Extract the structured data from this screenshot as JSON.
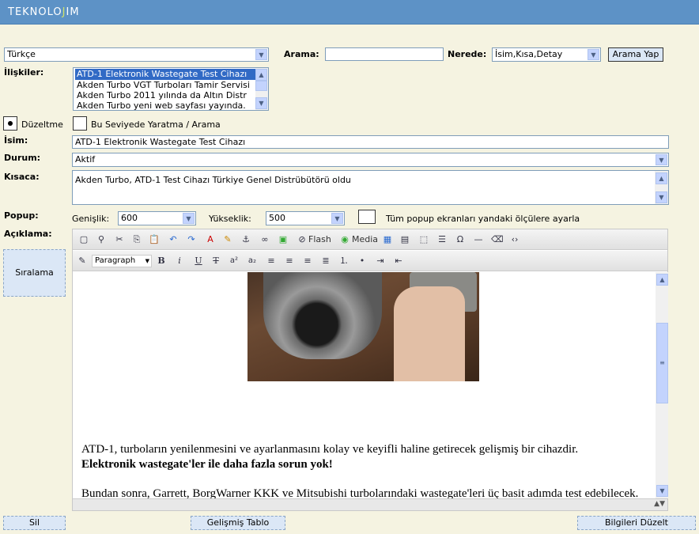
{
  "header": {
    "logo_prefix": "TEKNOLO",
    "logo_highlight": "J",
    "logo_suffix": "IM"
  },
  "language": {
    "value": "Türkçe"
  },
  "search": {
    "label": "Arama:",
    "value": "",
    "where_label": "Nerede:",
    "where_value": "İsim,Kısa,Detay",
    "button": "Arama Yap"
  },
  "relations": {
    "label": "İlişkiler:",
    "items": [
      "ATD-1 Elektronik Wastegate Test Cihazı",
      "Akden Turbo VGT Turboları Tamir Servisi",
      "Akden Turbo 2011 yılında da Altın Distr",
      "Akden Turbo yeni web sayfası yayında."
    ]
  },
  "mode": {
    "edit_label": "Düzeltme",
    "create_label": "Bu Seviyede Yaratma / Arama"
  },
  "name": {
    "label": "İsim:",
    "value": "ATD-1 Elektronik Wastegate Test Cihazı"
  },
  "status": {
    "label": "Durum:",
    "value": "Aktif"
  },
  "short": {
    "label": "Kısaca:",
    "value": "Akden Turbo, ATD-1 Test Cihazı Türkiye Genel Distrübütörü oldu"
  },
  "popup": {
    "label": "Popup:",
    "width_label": "Genişlik:",
    "width_value": "600",
    "height_label": "Yükseklik:",
    "height_value": "500",
    "all_label": "Tüm popup ekranları yandaki ölçülere ayarla"
  },
  "description": {
    "label": "Açıklama:"
  },
  "sort_button": "Sıralama",
  "editor": {
    "toolbar1": {
      "flash": "Flash",
      "media": "Media"
    },
    "toolbar2": {
      "format": "Paragraph",
      "bold": "B",
      "italic": "i",
      "underline": "U",
      "strike": "T"
    },
    "content": {
      "line1": "ATD-1, turboların yenilenmesini ve ayarlanmasını kolay ve keyifli haline getirecek gelişmiş bir cihazdir.",
      "line2": "Elektronik wastegate'ler ile daha fazla sorun yok!",
      "line3": "Bundan sonra, Garrett, BorgWarner KKK ve Mitsubishi turbolarındaki wastegate'leri üç basit adımda test edebilecek."
    }
  },
  "footer": {
    "delete": "Sil",
    "advanced_table": "Gelişmiş Tablo",
    "update": "Bilgileri Düzelt"
  },
  "colors": {
    "header": "#5d92c6",
    "background": "#f5f3e1",
    "button": "#dbe7f6"
  }
}
